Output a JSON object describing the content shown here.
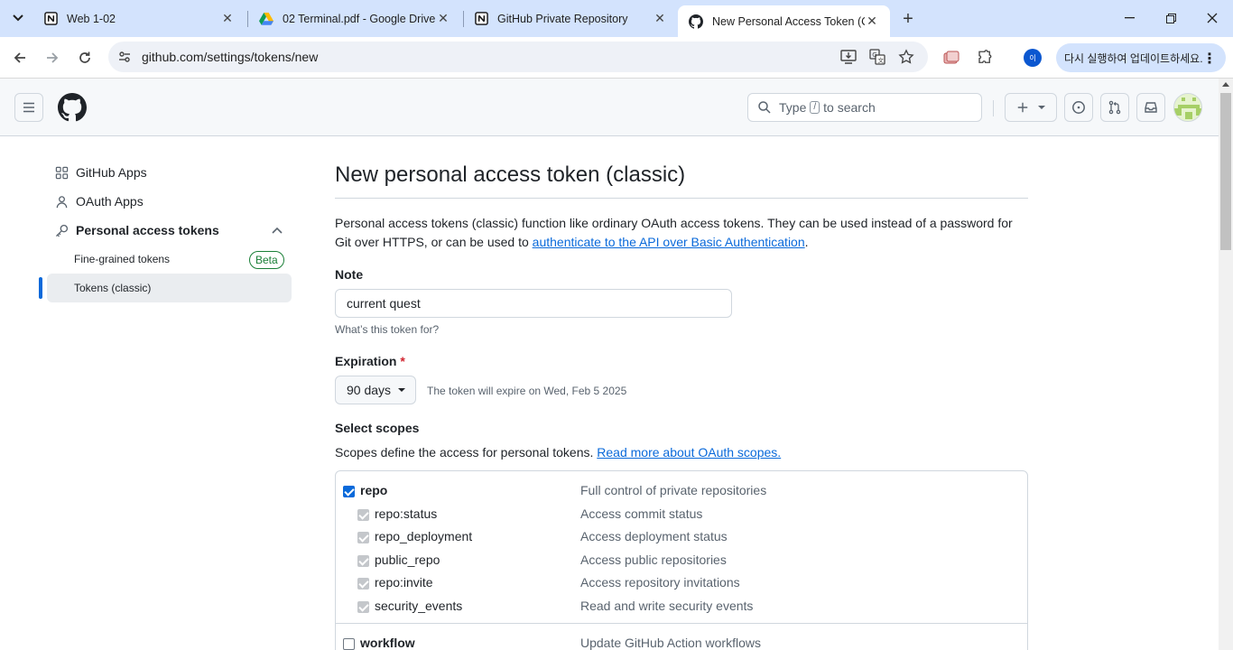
{
  "browser": {
    "tabs": [
      {
        "title": "Web 1-02",
        "icon": "notion-icon"
      },
      {
        "title": "02 Terminal.pdf - Google Drive",
        "icon": "google-drive-icon"
      },
      {
        "title": "GitHub Private Repository",
        "icon": "notion-icon"
      },
      {
        "title": "New Personal Access Token (C",
        "icon": "github-icon",
        "active": true
      }
    ],
    "url": "github.com/settings/tokens/new",
    "profile_initial": "이",
    "update_label": "다시 실행하여 업데이트하세요."
  },
  "header": {
    "search_prefix": "Type",
    "search_key": "/",
    "search_suffix": "to search"
  },
  "sidebar": {
    "items": [
      {
        "label": "GitHub Apps",
        "icon": "apps-grid-icon"
      },
      {
        "label": "OAuth Apps",
        "icon": "person-icon"
      },
      {
        "label": "Personal access tokens",
        "icon": "key-icon"
      }
    ],
    "subitems": [
      {
        "label": "Fine-grained tokens",
        "badge": "Beta"
      },
      {
        "label": "Tokens (classic)",
        "selected": true
      }
    ]
  },
  "main": {
    "title": "New personal access token (classic)",
    "intro_text": "Personal access tokens (classic) function like ordinary OAuth access tokens. They can be used instead of a password for Git over HTTPS, or can be used to ",
    "intro_link": "authenticate to the API over Basic Authentication",
    "intro_end": ".",
    "note_label": "Note",
    "note_value": "current quest",
    "note_hint": "What’s this token for?",
    "expiration_label": "Expiration",
    "expiration_required": "*",
    "expiration_value": "90 days",
    "expiration_note": "The token will expire on Wed, Feb 5 2025",
    "scopes_label": "Select scopes",
    "scopes_desc": "Scopes define the access for personal tokens. ",
    "scopes_link": "Read more about OAuth scopes.",
    "scopes": [
      {
        "name": "repo",
        "desc": "Full control of private repositories",
        "state": "checked",
        "parent": true
      },
      {
        "name": "repo:status",
        "desc": "Access commit status",
        "state": "disabled"
      },
      {
        "name": "repo_deployment",
        "desc": "Access deployment status",
        "state": "disabled"
      },
      {
        "name": "public_repo",
        "desc": "Access public repositories",
        "state": "disabled"
      },
      {
        "name": "repo:invite",
        "desc": "Access repository invitations",
        "state": "disabled"
      },
      {
        "name": "security_events",
        "desc": "Read and write security events",
        "state": "disabled"
      },
      {
        "name": "workflow",
        "desc": "Update GitHub Action workflows",
        "state": "empty",
        "parent": true
      }
    ]
  },
  "colors": {
    "accent": "#0969da",
    "tabstrip": "#d3e3fd",
    "success": "#1a7f37",
    "danger": "#d1242f"
  }
}
